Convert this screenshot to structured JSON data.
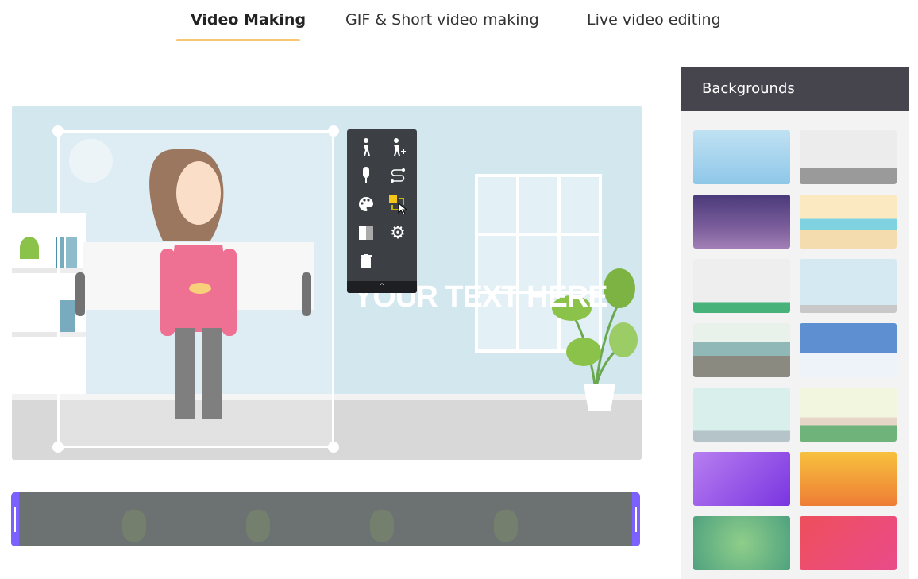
{
  "tabs": [
    {
      "label": "Video Making",
      "active": true
    },
    {
      "label": "GIF & Short video making",
      "active": false
    },
    {
      "label": "Live video editing",
      "active": false
    }
  ],
  "accent_color": "#f7c873",
  "canvas": {
    "overlay_text": "YOUR TEXT HERE"
  },
  "toolbar": {
    "tools": [
      "walk-icon",
      "walk-add-icon",
      "microphone-icon",
      "path-icon",
      "palette-icon",
      "swap-icon",
      "contrast-icon",
      "gear-icon",
      "trash-icon"
    ],
    "collapse": "^"
  },
  "timeline": {
    "handle_color": "#7b61ff"
  },
  "panel": {
    "title": "Backgrounds",
    "thumbnails": [
      {
        "name": "sky",
        "bg": "linear-gradient(#bfe1f3,#8fc7e8)"
      },
      {
        "name": "bedroom",
        "bg": "linear-gradient(#ececec 70%,#9a9a9a 70%)"
      },
      {
        "name": "city-night",
        "bg": "linear-gradient(#4a3a7a,#7b5d9b 60%,#a27fb5)"
      },
      {
        "name": "beach",
        "bg": "linear-gradient(#fbe9c2 45%,#7fd3e0 45%,#7fd3e0 65%,#f4dcae 65%)"
      },
      {
        "name": "room-green",
        "bg": "linear-gradient(#eeeeee 80%,#47b27a 80%)"
      },
      {
        "name": "office-blue",
        "bg": "linear-gradient(#d5e9f2 85%,#c8c8c8 85%)"
      },
      {
        "name": "seaside",
        "bg": "linear-gradient(#e9f2ea 35%,#8fb8b6 35%,#8fb8b6 60%,#8b8a80 60%)"
      },
      {
        "name": "winter-house",
        "bg": "linear-gradient(#5d8fd1 55%,#eef3fa 55%)"
      },
      {
        "name": "presentation",
        "bg": "linear-gradient(#d9efec 80%,#b5c4c8 80%)"
      },
      {
        "name": "farm",
        "bg": "linear-gradient(#f2f6df 55%,#e5d6c8 55%,#e5d6c8 70%,#6fb37a 70%)"
      },
      {
        "name": "purple-gradient",
        "bg": "linear-gradient(135deg,#b77ef0,#7a35e0)"
      },
      {
        "name": "orange-gradient",
        "bg": "linear-gradient(#f7c13e,#ee7d35)"
      },
      {
        "name": "green-gradient",
        "bg": "radial-gradient(circle at 50% 50%,#8fce8a,#4fa27f)"
      },
      {
        "name": "red-gradient",
        "bg": "linear-gradient(135deg,#ef4f5b,#e94b8a)"
      }
    ]
  }
}
